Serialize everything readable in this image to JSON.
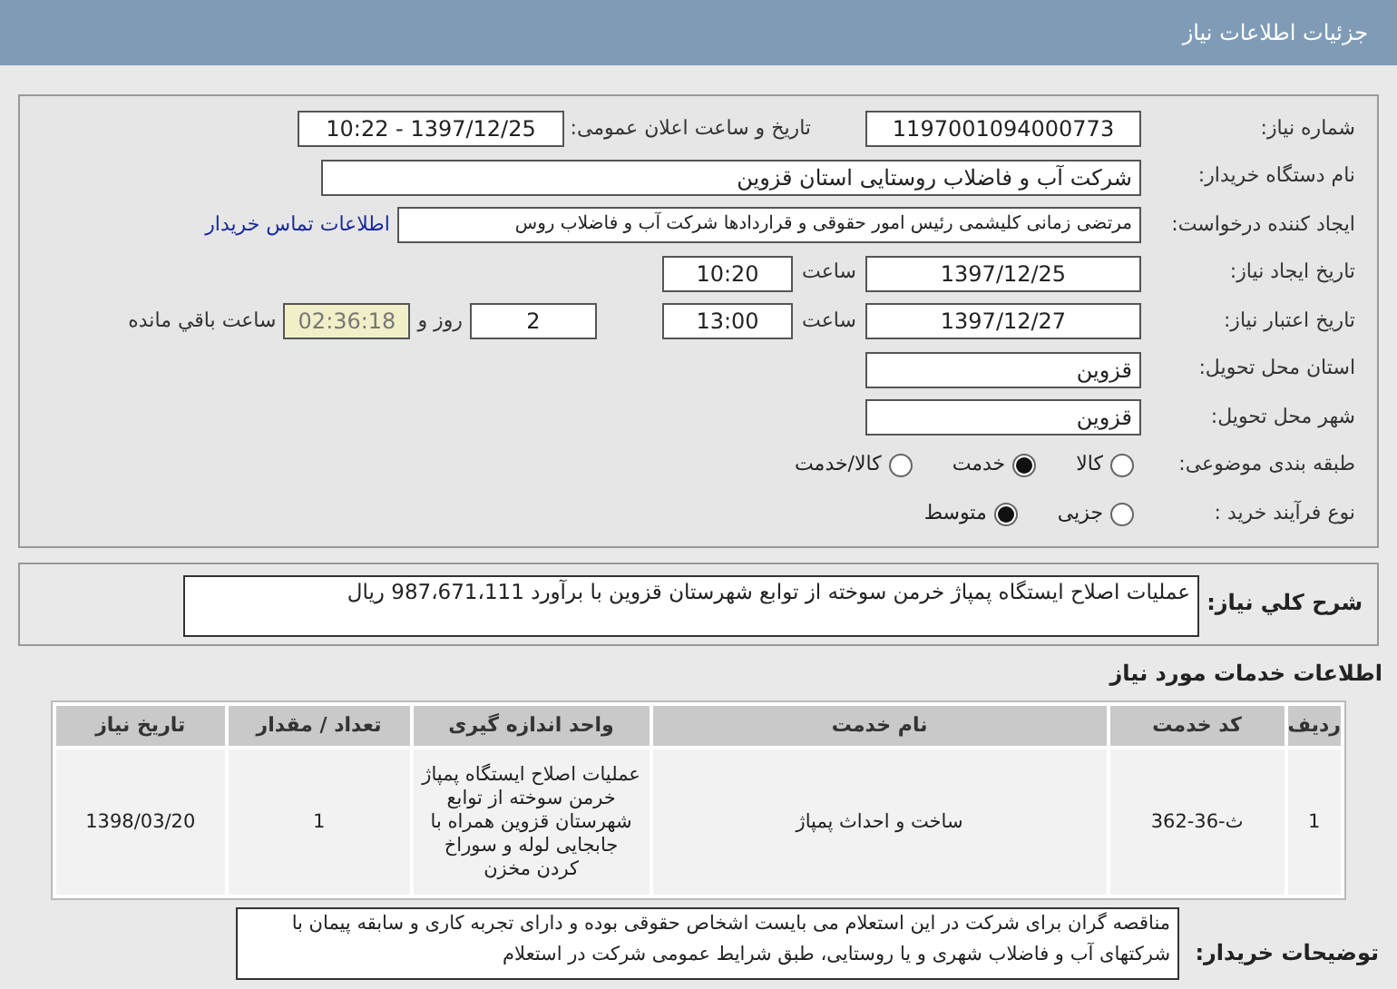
{
  "header": {
    "title": "جزئیات اطلاعات نیاز"
  },
  "details": {
    "need_number": {
      "label": "شماره نیاز:",
      "value": "1197001094000773"
    },
    "announce": {
      "label": "تاریخ و ساعت اعلان عمومی:",
      "value": "1397/12/25 - 10:22"
    },
    "buyer": {
      "label": "نام دستگاه خریدار:",
      "value": "شرکت آب و فاضلاب روستایی استان قزوین"
    },
    "creator": {
      "label": "ایجاد کننده درخواست:",
      "value": "مرتضی زمانی کلیشمی رئیس امور حقوقی و قراردادها شرکت آب و فاضلاب روس",
      "link": "اطلاعات تماس خریدار"
    },
    "created": {
      "label": "تاریخ ایجاد نیاز:",
      "date": "1397/12/25",
      "time_label": "ساعت",
      "time": "10:20"
    },
    "valid": {
      "label": "تاریخ اعتبار نیاز:",
      "date": "1397/12/27",
      "time_label": "ساعت",
      "time": "13:00",
      "days": "2",
      "days_label": "روز و",
      "remaining": "02:36:18",
      "remaining_label": "ساعت باقي مانده"
    },
    "province": {
      "label": "استان محل تحویل:",
      "value": "قزوین"
    },
    "city": {
      "label": "شهر محل تحویل:",
      "value": "قزوین"
    },
    "category": {
      "label": "طبقه بندی موضوعی:",
      "options": [
        {
          "label": "کالا",
          "selected": false
        },
        {
          "label": "خدمت",
          "selected": true
        },
        {
          "label": "کالا/خدمت",
          "selected": false
        }
      ]
    },
    "process": {
      "label": "نوع فرآیند خرید :",
      "options": [
        {
          "label": "جزیی",
          "selected": false
        },
        {
          "label": "متوسط",
          "selected": true
        }
      ]
    }
  },
  "summary": {
    "label": "شرح کلي نیاز:",
    "value": "عملیات اصلاح ایستگاه پمپاژ خرمن سوخته از توابع شهرستان قزوین با برآورد 987،671،111 ریال"
  },
  "services": {
    "title": "اطلاعات خدمات مورد نیاز",
    "columns": [
      "ردیف",
      "کد خدمت",
      "نام خدمت",
      "واحد اندازه گیری",
      "تعداد / مقدار",
      "تاریخ نیاز"
    ],
    "rows": [
      [
        "1",
        "ث-36-362",
        "ساخت و احداث پمپاژ",
        "عملیات اصلاح ایستگاه پمپاژ خرمن سوخته از توابع شهرستان قزوین همراه با جابجایی لوله و سوراخ کردن مخزن",
        "1",
        "1398/03/20"
      ]
    ]
  },
  "notes": {
    "label": "توضیحات خریدار:",
    "value": "مناقصه گران برای شرکت در این استعلام می بایست  اشخاص حقوقی  بوده  و دارای تجربه کاری و سابقه پیمان با  شرکتهای آب و فاضلاب شهری و یا روستایی، طبق شرایط عمومی شرکت در استعلام"
  }
}
